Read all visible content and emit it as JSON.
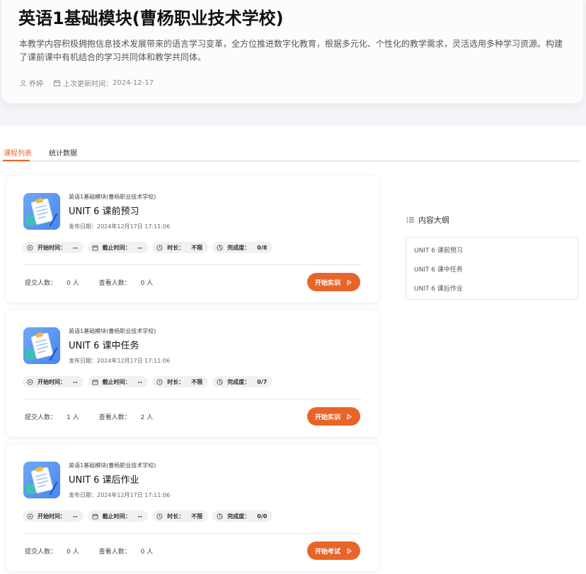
{
  "course": {
    "title": "英语1基础模块(曹杨职业技术学校)",
    "description": "本教学内容积极拥抱信息技术发展带来的语言学习变革，全方位推进数字化教育，根据多元化、个性化的教学需求，灵活选用多种学习资源。构建了课前课中有机结合的学习共同体和教学共同体。",
    "author": "乔婷",
    "updated_label": "上次更新时间：",
    "updated_date": "2024-12-17"
  },
  "tabs": [
    {
      "label": "课程列表",
      "active": true
    },
    {
      "label": "统计数据",
      "active": false
    }
  ],
  "labels": {
    "start": "开始时间：",
    "end": "截止时间：",
    "duration": "时长：",
    "completion": "完成度：",
    "submit": "提交人数：",
    "view": "查看人数："
  },
  "tasks": [
    {
      "course": "英语1基础模块(曹杨职业技术学校)",
      "title": "UNIT 6 课前预习",
      "date": "发布日期：2024年12月17日 17:11:06",
      "start": "--",
      "end": "--",
      "duration": "不限",
      "completion": "0/8",
      "submit": "0 人",
      "view": "0 人",
      "button": "开始实训"
    },
    {
      "course": "英语1基础模块(曹杨职业技术学校)",
      "title": "UNIT 6 课中任务",
      "date": "发布日期：2024年12月17日 17:11:06",
      "start": "--",
      "end": "--",
      "duration": "不限",
      "completion": "0/7",
      "submit": "1 人",
      "view": "2 人",
      "button": "开始实训"
    },
    {
      "course": "英语1基础模块(曹杨职业技术学校)",
      "title": "UNIT 6 课后作业",
      "date": "发布日期：2024年12月17日 17:11:06",
      "start": "--",
      "end": "--",
      "duration": "不限",
      "completion": "0/0",
      "submit": "0 人",
      "view": "0 人",
      "button": "开始考试"
    }
  ],
  "outline": {
    "title": "内容大纲",
    "items": [
      "UNIT 6 课前预习",
      "UNIT 6 课中任务",
      "UNIT 6 课后作业"
    ]
  },
  "colors": {
    "accent": "#e8652a",
    "thumb": "#4a86ef"
  }
}
